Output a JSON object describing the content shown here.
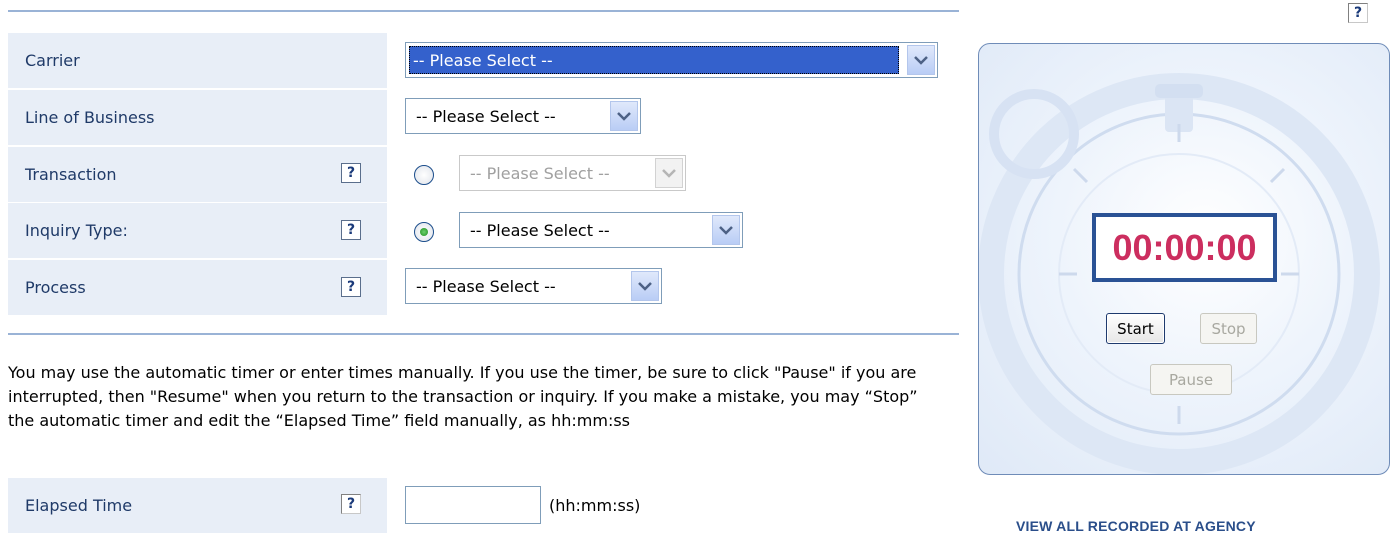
{
  "form": {
    "rows": [
      {
        "label": "Carrier",
        "select": "-- Please Select --"
      },
      {
        "label": "Line of Business",
        "select": "-- Please Select --"
      },
      {
        "label": "Transaction",
        "select": "-- Please Select --",
        "radio_selected": false,
        "help": "?"
      },
      {
        "label": "Inquiry Type:",
        "select": "-- Please Select --",
        "radio_selected": true,
        "help": "?"
      },
      {
        "label": "Process",
        "select": "-- Please Select --",
        "help": "?"
      }
    ],
    "instructions": "You may use the automatic timer or enter times manually. If you use the timer, be sure to click \"Pause\" if you are interrupted, then \"Resume\" when you return to the transaction or inquiry. If you make a mistake, you may “Stop” the automatic timer and edit the “Elapsed Time” field manually, as hh:mm:ss",
    "elapsed": {
      "label": "Elapsed Time",
      "value": "",
      "hint": "(hh:mm:ss)",
      "help": "?"
    }
  },
  "timer": {
    "display": "00:00:00",
    "start_label": "Start",
    "stop_label": "Stop",
    "pause_label": "Pause",
    "help": "?"
  },
  "links": {
    "view_all": "VIEW ALL RECORDED AT AGENCY"
  },
  "colors": {
    "label_bg": "#e8eef7",
    "label_text": "#1f3a68",
    "timer_text": "#cc2e5f",
    "selected_option_bg": "#3461cc"
  }
}
